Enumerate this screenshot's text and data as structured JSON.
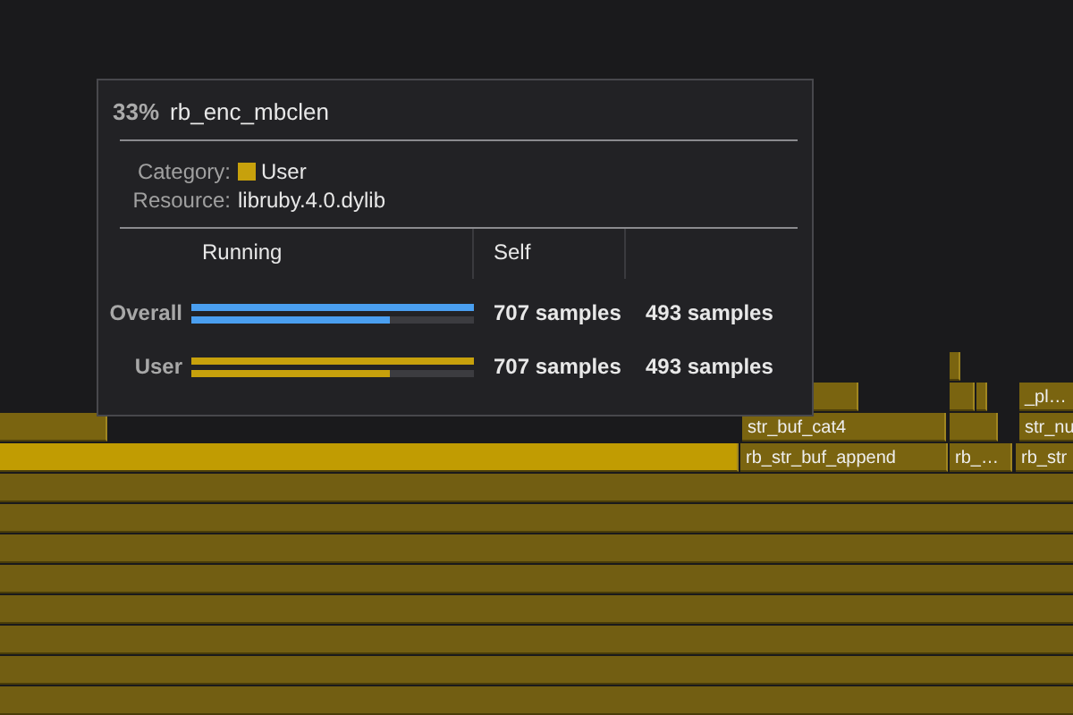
{
  "flame_graph": {
    "frames": [
      {
        "label": "_pl…",
        "selected": false
      },
      {
        "label": "str_buf_cat4",
        "selected": false
      },
      {
        "label": "str_nu",
        "selected": false
      },
      {
        "selected": true
      },
      {
        "label": "rb_str_buf_append",
        "selected": false
      },
      {
        "label": "rb_…",
        "selected": false
      },
      {
        "label": "rb_str",
        "selected": false
      }
    ]
  },
  "tooltip": {
    "percent": "33%",
    "function": "rb_enc_mbclen",
    "details": [
      {
        "label": "Category:",
        "value": "User",
        "color": "#c7a10c"
      },
      {
        "label": "Resource:",
        "value": "libruby.4.0.dylib"
      }
    ],
    "columns": [
      "Running",
      "Self"
    ],
    "rows": [
      {
        "label": "Overall",
        "kind": "overall",
        "meters": [
          {
            "level": 1
          },
          {
            "level": 0.7
          }
        ],
        "running": "707 samples",
        "self": "493 samples"
      },
      {
        "label": "User",
        "kind": "user",
        "meters": [
          {
            "level": 1
          },
          {
            "level": 0.7
          }
        ],
        "running": "707 samples",
        "self": "493 samples"
      }
    ]
  }
}
